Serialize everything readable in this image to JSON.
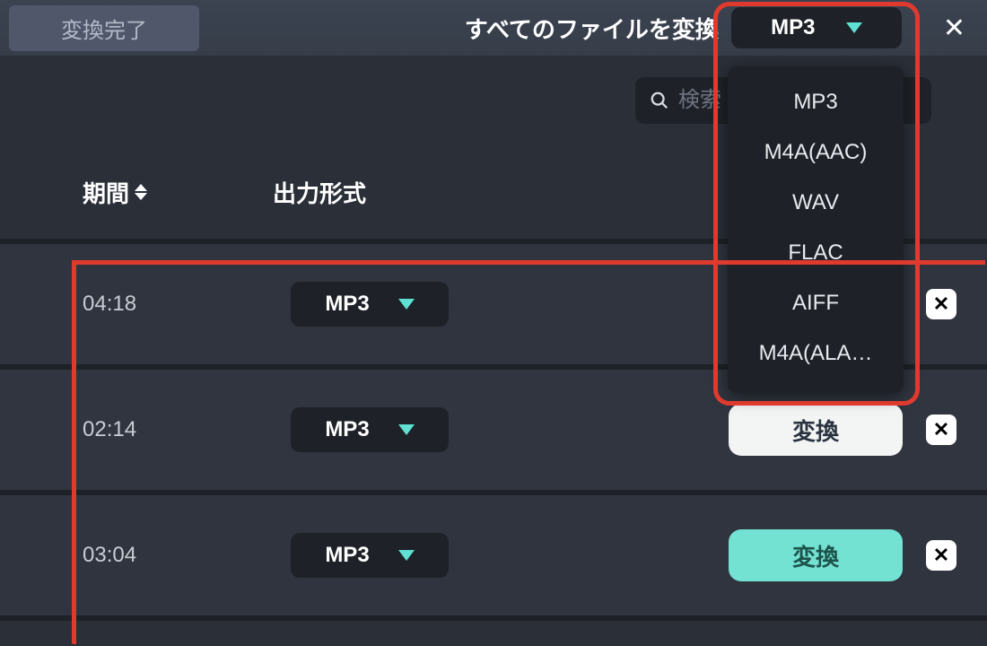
{
  "header": {
    "tab_complete_label": "変換完了",
    "convert_all_label": "すべてのファイルを変換",
    "selected_format": "MP3"
  },
  "search": {
    "placeholder": "検索（タ"
  },
  "columns": {
    "duration": "期間",
    "output_format": "出力形式"
  },
  "format_options": [
    "MP3",
    "M4A(AAC)",
    "WAV",
    "FLAC",
    "AIFF",
    "M4A(ALA…"
  ],
  "rows": [
    {
      "duration": "04:18",
      "format": "MP3",
      "convert_label": "",
      "style": "hidden"
    },
    {
      "duration": "02:14",
      "format": "MP3",
      "convert_label": "変換",
      "style": "white"
    },
    {
      "duration": "03:04",
      "format": "MP3",
      "convert_label": "変換",
      "style": "teal"
    }
  ]
}
